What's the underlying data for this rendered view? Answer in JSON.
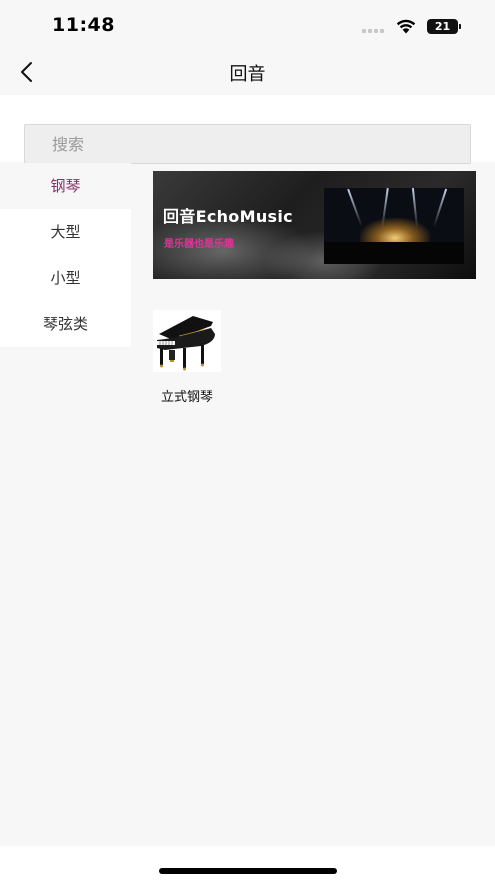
{
  "status_bar": {
    "time": "11:48",
    "battery": "21"
  },
  "nav": {
    "title": "回音",
    "back_icon": "chevron-left-icon"
  },
  "search": {
    "placeholder": "搜索"
  },
  "sidebar": {
    "items": [
      {
        "label": "钢琴",
        "active": true
      },
      {
        "label": "大型",
        "active": false
      },
      {
        "label": "小型",
        "active": false
      },
      {
        "label": "琴弦类",
        "active": false
      }
    ]
  },
  "banner": {
    "title": "回音EchoMusic",
    "subtitle": "是乐器也是乐趣"
  },
  "products": [
    {
      "label": "立式钢琴",
      "icon": "grand-piano-image"
    }
  ],
  "colors": {
    "accent": "#8a2f6a",
    "banner_subtitle": "#e0339a",
    "background": "#f7f7f7"
  }
}
